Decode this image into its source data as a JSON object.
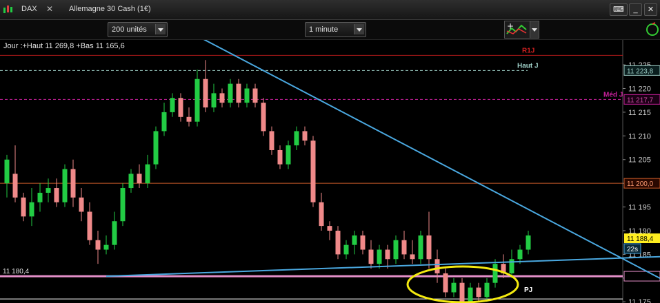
{
  "header": {
    "symbol": "DAX",
    "instrument": "Allemagne 30 Cash (1€)",
    "icons": [
      "candlestick-icon",
      "close-icon",
      "keyboard-icon",
      "minimize-icon",
      "close-window-icon"
    ]
  },
  "toolbar": {
    "units_select": "200 unités",
    "interval_select": "1 minute"
  },
  "chart_info": "Jour :+Haut 11 269,8 +Bas 11 165,6",
  "colors": {
    "up_candle": "#22cc44",
    "down_candle": "#f08a8a",
    "trendline": "#4aa8e0",
    "r1_line": "#b01a1a",
    "haut_line": "#9fd0c8",
    "med_line": "#c8209a",
    "level_11200": "#c85a28",
    "pink_support": "#e48fc8",
    "ellipse": "#f4ea10",
    "white_line": "#ffffff"
  },
  "chart_data": {
    "type": "candlestick",
    "y_ticks": [
      "11 225",
      "11 220",
      "11 215",
      "11 210",
      "11 205",
      "11 200",
      "11 195",
      "11 190",
      "11 185",
      "11 180",
      "11 175"
    ],
    "y_range": [
      11173.0,
      11228.5
    ],
    "levels": [
      {
        "label": "R1J",
        "price": 11227
      },
      {
        "label": "Haut J",
        "price": 11223.8,
        "price_label": "11 223,8"
      },
      {
        "label": "Méd J",
        "price": 11217.7,
        "price_label": "11 217,7"
      },
      {
        "label": "",
        "price": 11200.0,
        "price_label": "11 200,0"
      },
      {
        "label": "",
        "price": 11180.4,
        "price_label": "11 180,4"
      },
      {
        "label": "PJ",
        "price": 11175.6
      }
    ],
    "last_price": "11 188,4",
    "countdown": "22s",
    "candles": [
      [
        11200,
        11205,
        11197,
        11206
      ],
      [
        11202,
        11197,
        11196,
        11208
      ],
      [
        11197,
        11193,
        11192,
        11198
      ],
      [
        11193,
        11196,
        11191,
        11199
      ],
      [
        11196,
        11198,
        11194,
        11200
      ],
      [
        11198,
        11199,
        11196,
        11201
      ],
      [
        11199,
        11196,
        11195,
        11201
      ],
      [
        11196,
        11203,
        11195,
        11204
      ],
      [
        11203,
        11197,
        11195,
        11205
      ],
      [
        11197,
        11194,
        11192,
        11199
      ],
      [
        11194,
        11188,
        11187,
        11196
      ],
      [
        11188,
        11186,
        11183,
        11190
      ],
      [
        11186,
        11187,
        11185,
        11189
      ],
      [
        11187,
        11192,
        11186,
        11194
      ],
      [
        11192,
        11199,
        11191,
        11200
      ],
      [
        11199,
        11202,
        11198,
        11203
      ],
      [
        11202,
        11200,
        11199,
        11204
      ],
      [
        11200,
        11204,
        11199,
        11206
      ],
      [
        11204,
        11211,
        11203,
        11212
      ],
      [
        11211,
        11215,
        11210,
        11217
      ],
      [
        11215,
        11218,
        11214,
        11219
      ],
      [
        11218,
        11214,
        11213,
        11219
      ],
      [
        11214,
        11213,
        11212,
        11216
      ],
      [
        11213,
        11222,
        11212,
        11224
      ],
      [
        11222,
        11216,
        11215,
        11226
      ],
      [
        11216,
        11219,
        11215,
        11221
      ],
      [
        11219,
        11217,
        11216,
        11220
      ],
      [
        11217,
        11221,
        11216,
        11222
      ],
      [
        11221,
        11217,
        11216,
        11222
      ],
      [
        11217,
        11220,
        11216,
        11221
      ],
      [
        11220,
        11217,
        11216,
        11221
      ],
      [
        11217,
        11211,
        11210,
        11218
      ],
      [
        11211,
        11207,
        11206,
        11212
      ],
      [
        11207,
        11204,
        11203,
        11208
      ],
      [
        11204,
        11208,
        11203,
        11209
      ],
      [
        11208,
        11211,
        11207,
        11212
      ],
      [
        11211,
        11209,
        11208,
        11212
      ],
      [
        11209,
        11196,
        11195,
        11210
      ],
      [
        11196,
        11191,
        11190,
        11198
      ],
      [
        11191,
        11190,
        11188,
        11192
      ],
      [
        11190,
        11185,
        11184,
        11191
      ],
      [
        11185,
        11187,
        11184,
        11188
      ],
      [
        11187,
        11189,
        11185,
        11190
      ],
      [
        11189,
        11186,
        11185,
        11190
      ],
      [
        11186,
        11183,
        11182,
        11188
      ],
      [
        11183,
        11186,
        11182,
        11187
      ],
      [
        11186,
        11184,
        11182,
        11187
      ],
      [
        11184,
        11188,
        11183,
        11189
      ],
      [
        11188,
        11185,
        11184,
        11190
      ],
      [
        11185,
        11184,
        11183,
        11188
      ],
      [
        11184,
        11189,
        11183,
        11190
      ],
      [
        11189,
        11184,
        11182,
        11194
      ],
      [
        11184,
        11181,
        11179,
        11186
      ],
      [
        11181,
        11177,
        11176,
        11182
      ],
      [
        11177,
        11179,
        11176,
        11180
      ],
      [
        11179,
        11175,
        11174,
        11180
      ],
      [
        11175,
        11178,
        11174,
        11179
      ],
      [
        11178,
        11176,
        11175,
        11179
      ],
      [
        11176,
        11179,
        11175,
        11180
      ],
      [
        11179,
        11183,
        11178,
        11184
      ],
      [
        11183,
        11181,
        11180,
        11185
      ],
      [
        11181,
        11184,
        11180,
        11186
      ],
      [
        11184,
        11186,
        11183,
        11187
      ],
      [
        11186,
        11189,
        11185,
        11190
      ]
    ],
    "trendlines": [
      {
        "x0": 22,
        "y0": 11232,
        "x1": 64,
        "y1": 11193.6
      },
      {
        "x0": 12,
        "y0": 11180.4,
        "x1": 64,
        "y1": 11183.6
      }
    ]
  }
}
